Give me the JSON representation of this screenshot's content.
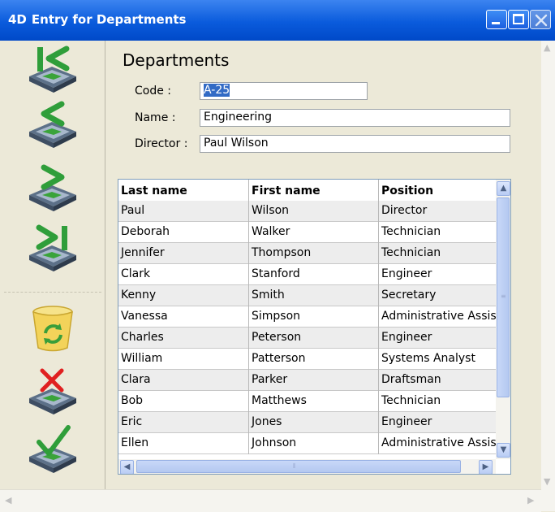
{
  "window": {
    "logo": "4D",
    "title": "Entry for Departments"
  },
  "toolbar": {
    "buttons": [
      "first-record",
      "previous-record",
      "next-record",
      "last-record",
      "delete-record",
      "cancel",
      "accept"
    ]
  },
  "form": {
    "title": "Departments",
    "code_label": "Code :",
    "code_value": "A-25",
    "name_label": "Name :",
    "name_value": "Engineering",
    "director_label": "Director :",
    "director_value": "Paul Wilson"
  },
  "grid": {
    "columns": [
      "Last name",
      "First name",
      "Position"
    ],
    "rows": [
      [
        "Paul",
        "Wilson",
        "Director"
      ],
      [
        "Deborah",
        "Walker",
        "Technician"
      ],
      [
        "Jennifer",
        "Thompson",
        "Technician"
      ],
      [
        "Clark",
        "Stanford",
        "Engineer"
      ],
      [
        "Kenny",
        "Smith",
        "Secretary"
      ],
      [
        "Vanessa",
        "Simpson",
        "Administrative Assistant"
      ],
      [
        "Charles",
        "Peterson",
        "Engineer"
      ],
      [
        "William",
        "Patterson",
        "Systems Analyst"
      ],
      [
        "Clara",
        "Parker",
        "Draftsman"
      ],
      [
        "Bob",
        "Matthews",
        "Technician"
      ],
      [
        "Eric",
        "Jones",
        "Engineer"
      ],
      [
        "Ellen",
        "Johnson",
        "Administrative Assistant"
      ]
    ]
  },
  "colors": {
    "titlebar": "#0A5BDC",
    "selection": "#316AC5",
    "background": "#ECE9D8"
  }
}
